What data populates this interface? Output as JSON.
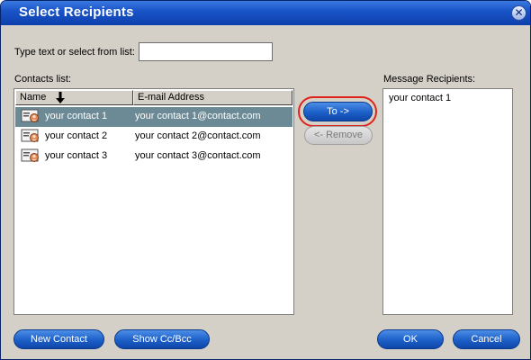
{
  "window": {
    "title": "Select Recipients",
    "close_glyph": "✕"
  },
  "search": {
    "label": "Type text or select from list:",
    "value": "",
    "placeholder": ""
  },
  "contacts": {
    "label": "Contacts list:",
    "columns": {
      "name": "Name",
      "email": "E-mail Address"
    },
    "sort_icon": "arrow-down-icon",
    "rows": [
      {
        "name": "your contact 1",
        "email": "your contact 1@contact.com",
        "selected": true
      },
      {
        "name": "your contact 2",
        "email": "your contact 2@contact.com",
        "selected": false
      },
      {
        "name": "your contact 3",
        "email": "your contact 3@contact.com",
        "selected": false
      }
    ]
  },
  "actions": {
    "to_label": "To ->",
    "remove_label": "<- Remove"
  },
  "recipients": {
    "label": "Message Recipients:",
    "items": [
      "your contact 1"
    ]
  },
  "footer": {
    "new_contact": "New Contact",
    "show_cc_bcc": "Show Cc/Bcc",
    "ok": "OK",
    "cancel": "Cancel"
  },
  "colors": {
    "title_bar": "#1a55c8",
    "button": "#1c5fc8",
    "selection": "#6b8a96",
    "highlight_ring": "#e0231a"
  }
}
